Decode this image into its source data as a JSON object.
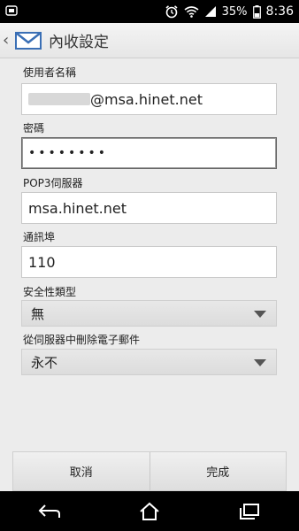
{
  "status_bar": {
    "battery_percent": "35%",
    "time": "8:36"
  },
  "action_bar": {
    "title": "內收設定",
    "back_icon": "chevron-left-icon",
    "app_icon": "mail-envelope-icon"
  },
  "form": {
    "username_label": "使用者名稱",
    "username_value": "@msa.hinet.net",
    "password_label": "密碼",
    "password_value": "••••••••",
    "server_label": "POP3伺服器",
    "server_value": "msa.hinet.net",
    "port_label": "通訊埠",
    "port_value": "110",
    "security_label": "安全性類型",
    "security_value": "無",
    "delete_label": "從伺服器中刪除電子郵件",
    "delete_value": "永不"
  },
  "buttons": {
    "cancel": "取消",
    "done": "完成"
  },
  "nav_bar": {
    "back_icon": "back-arrow-icon",
    "home_icon": "home-icon",
    "recents_icon": "recents-icon"
  }
}
